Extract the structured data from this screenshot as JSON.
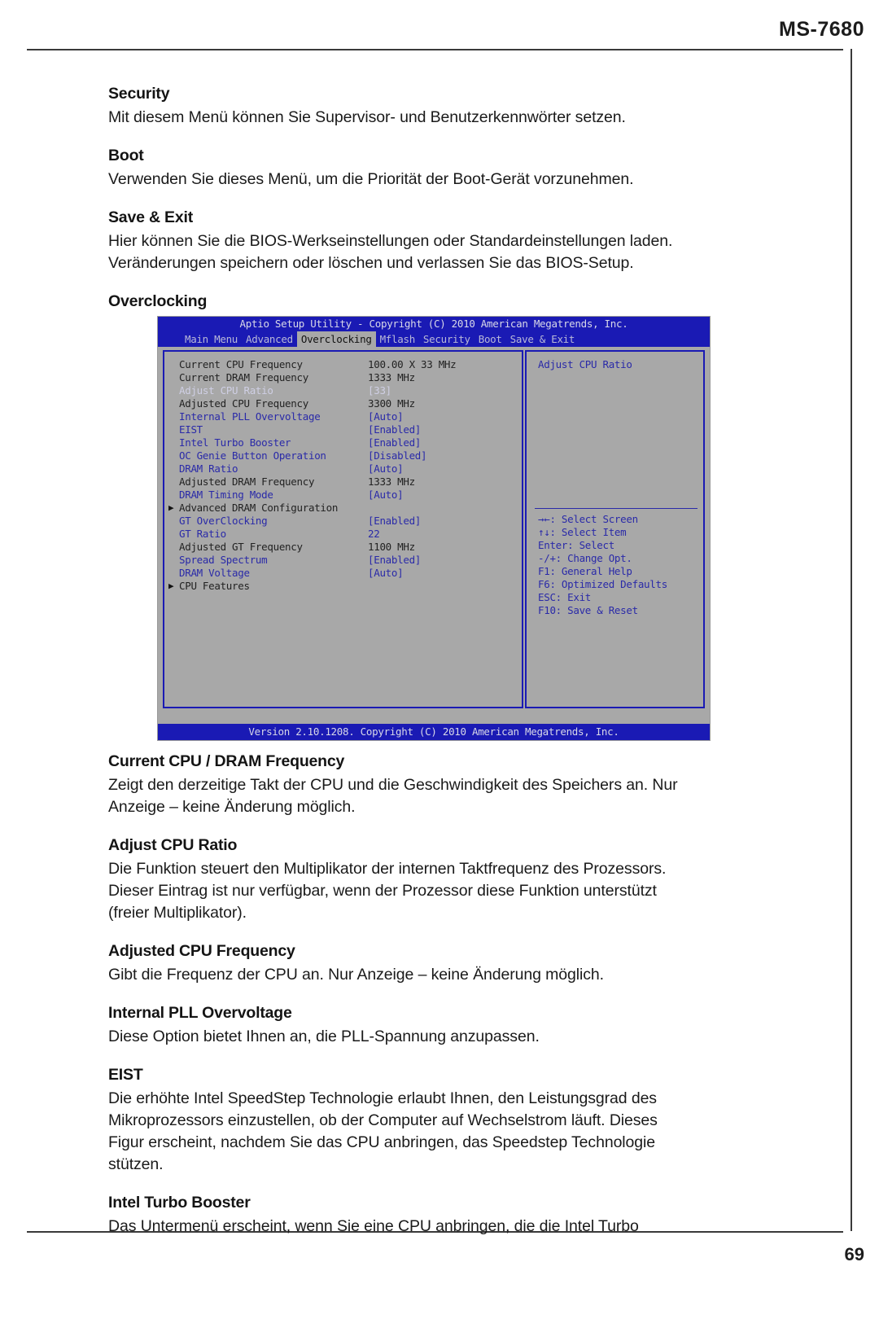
{
  "header": {
    "model_code": "MS-7680"
  },
  "footer": {
    "page_number": "69"
  },
  "sections_top": [
    {
      "heading": "Security",
      "lines": [
        "Mit diesem Menü können Sie Supervisor- und Benutzerkennwörter setzen."
      ]
    },
    {
      "heading": "Boot",
      "lines": [
        "Verwenden Sie dieses Menü, um die Priorität der Boot-Gerät vorzunehmen."
      ]
    },
    {
      "heading": "Save & Exit",
      "lines": [
        "Hier können Sie die BIOS-Werkseinstellungen oder Standardeinstellungen laden.",
        "Veränderungen speichern oder löschen und verlassen Sie das BIOS-Setup."
      ]
    }
  ],
  "overclocking_heading": "Overclocking",
  "bios": {
    "title": "Aptio Setup Utility - Copyright (C) 2010 American Megatrends, Inc.",
    "menu": [
      {
        "label": "Main Menu",
        "active": false
      },
      {
        "label": "Advanced",
        "active": false
      },
      {
        "label": "Overclocking",
        "active": true
      },
      {
        "label": "Mflash",
        "active": false
      },
      {
        "label": "Security",
        "active": false
      },
      {
        "label": "Boot",
        "active": false
      },
      {
        "label": "Save & Exit",
        "active": false
      }
    ],
    "rows": [
      {
        "label": "Current CPU Frequency",
        "value": "100.00 X 33 MHz",
        "style": "dark",
        "submenu": false
      },
      {
        "label": "Current DRAM Frequency",
        "value": "1333 MHz",
        "style": "dark",
        "submenu": false
      },
      {
        "label": "Adjust CPU Ratio",
        "value": "[33]",
        "style": "hl",
        "submenu": false
      },
      {
        "label": "Adjusted CPU Frequency",
        "value": "3300 MHz",
        "style": "dark",
        "submenu": false
      },
      {
        "label": "Internal PLL Overvoltage",
        "value": "[Auto]",
        "style": "blue",
        "submenu": false
      },
      {
        "label": "EIST",
        "value": "[Enabled]",
        "style": "blue",
        "submenu": false
      },
      {
        "label": "Intel Turbo Booster",
        "value": "[Enabled]",
        "style": "blue",
        "submenu": false
      },
      {
        "label": "OC Genie Button Operation",
        "value": "[Disabled]",
        "style": "blue",
        "submenu": false
      },
      {
        "label": "DRAM Ratio",
        "value": "[Auto]",
        "style": "blue",
        "submenu": false
      },
      {
        "label": "Adjusted DRAM Frequency",
        "value": "1333 MHz",
        "style": "dark",
        "submenu": false
      },
      {
        "label": "DRAM Timing Mode",
        "value": "[Auto]",
        "style": "blue",
        "submenu": false
      },
      {
        "label": "Advanced DRAM Configuration",
        "value": "",
        "style": "dark",
        "submenu": true
      },
      {
        "label": "GT OverClocking",
        "value": "[Enabled]",
        "style": "blue",
        "submenu": false
      },
      {
        "label": "GT Ratio",
        "value": "22",
        "style": "blue",
        "submenu": false
      },
      {
        "label": "Adjusted GT Frequency",
        "value": "1100 MHz",
        "style": "dark",
        "submenu": false
      },
      {
        "label": "Spread Spectrum",
        "value": "[Enabled]",
        "style": "blue",
        "submenu": false
      },
      {
        "label": "DRAM Voltage",
        "value": "[Auto]",
        "style": "blue",
        "submenu": false
      },
      {
        "label": "CPU Features",
        "value": "",
        "style": "dark",
        "submenu": true
      }
    ],
    "help_title": "Adjust CPU Ratio",
    "help_keys": [
      "→←: Select Screen",
      "↑↓: Select Item",
      "Enter: Select",
      "-/+: Change Opt.",
      "F1: General Help",
      "F6: Optimized Defaults",
      "ESC: Exit",
      "F10: Save & Reset"
    ],
    "version_line": "Version 2.10.1208. Copyright (C) 2010 American Megatrends, Inc."
  },
  "sections_bottom": [
    {
      "heading": "Current CPU / DRAM Frequency",
      "lines": [
        "Zeigt den derzeitige Takt der CPU und die Geschwindigkeit des Speichers an. Nur",
        "Anzeige – keine Änderung möglich."
      ]
    },
    {
      "heading": "Adjust CPU Ratio",
      "lines": [
        "Die Funktion steuert den Multiplikator der internen Taktfrequenz des Prozessors.",
        "Dieser Eintrag ist nur verfügbar, wenn der Prozessor diese Funktion unterstützt",
        "(freier Multiplikator)."
      ]
    },
    {
      "heading": "Adjusted CPU Frequency",
      "lines": [
        "Gibt die Frequenz der CPU an. Nur Anzeige – keine Änderung möglich."
      ]
    },
    {
      "heading": "Internal PLL Overvoltage",
      "lines": [
        "Diese Option bietet Ihnen an, die PLL-Spannung anzupassen."
      ]
    },
    {
      "heading": "EIST",
      "lines": [
        "Die erhöhte Intel SpeedStep Technologie erlaubt Ihnen, den Leistungsgrad des",
        "Mikroprozessors einzustellen, ob der Computer auf Wechselstrom läuft. Dieses",
        "Figur erscheint, nachdem Sie das CPU anbringen, das Speedstep Technologie",
        "stützen."
      ]
    },
    {
      "heading": "Intel Turbo Booster",
      "lines": [
        "Das Untermenü erscheint, wenn Sie eine CPU anbringen, die die Intel Turbo"
      ]
    }
  ]
}
